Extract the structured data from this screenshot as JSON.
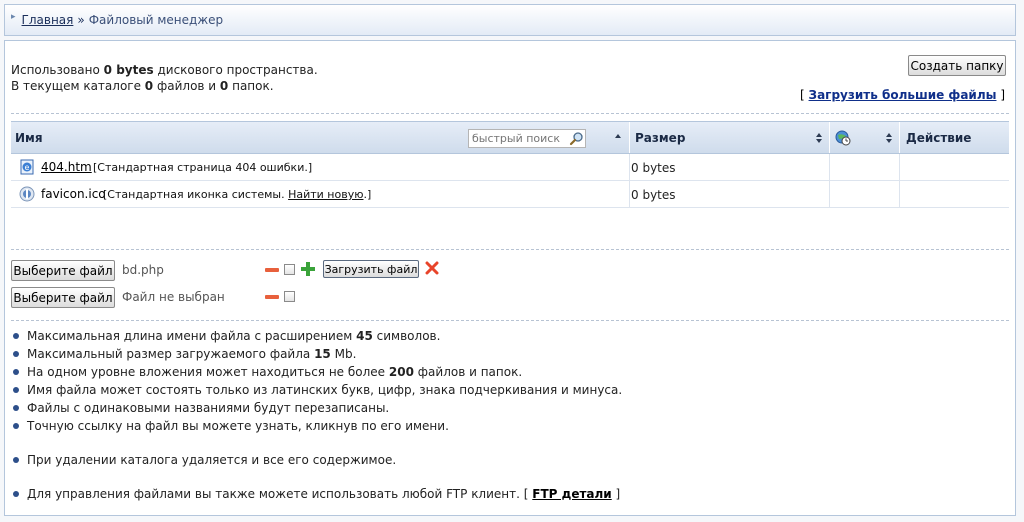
{
  "breadcrumb": {
    "home": "Главная",
    "separator": "»",
    "current": "Файловый менеджер"
  },
  "usage": {
    "line1_prefix": "Использовано",
    "used": "0 bytes",
    "line1_suffix": "дискового пространства.",
    "line2_prefix": "В текущем каталоге",
    "files_count": "0",
    "line2_mid": "файлов и",
    "folders_count": "0",
    "line2_suffix": "папок."
  },
  "toolbar": {
    "create_folder": "Создать папку",
    "upload_big_open": "[",
    "upload_big": "Загрузить большие файлы",
    "upload_big_close": "]"
  },
  "table": {
    "col_name": "Имя",
    "search_placeholder": "быстрый поиск",
    "col_size": "Размер",
    "col_action": "Действие",
    "rows": [
      {
        "name": "404.htm",
        "desc": "[Стандартная страница 404 ошибки.]",
        "size": "0 bytes",
        "icon": "html-file-icon"
      },
      {
        "name": "favicon.ico",
        "desc_prefix": "[Стандартная иконка системы.",
        "desc_link": "Найти новую",
        "desc_suffix": ".]",
        "size": "0 bytes",
        "icon": "favicon-file-icon"
      }
    ]
  },
  "upload": {
    "choose_label": "Выберите файл",
    "row1_file": "bd.php",
    "row2_file": "Файл не выбран",
    "upload_button": "Загрузить файл"
  },
  "info": {
    "i1_a": "Максимальная длина имени файла с расширением",
    "i1_b": "45",
    "i1_c": "символов.",
    "i2_a": "Максимальный размер загружаемого файла",
    "i2_b": "15",
    "i2_c": "Mb.",
    "i3_a": "На одном уровне вложения может находиться не более",
    "i3_b": "200",
    "i3_c": "файлов и папок.",
    "i4": "Имя файла может состоять только из латинских букв, цифр, знака подчеркивания и минуса.",
    "i5": "Файлы с одинаковыми названиями будут перезаписаны.",
    "i6": "Точную ссылку на файл вы можете узнать, кликнув по его имени.",
    "i7": "При удалении каталога удаляется и все его содержимое.",
    "i8_a": "Для управления файлами вы также можете использовать любой FTP клиент.",
    "i8_open": "[",
    "i8_link": "FTP детали",
    "i8_close": "]"
  },
  "colors": {
    "accent": "#0f2f8a",
    "header_bg": "#d4e0ef",
    "border": "#b4c6dc",
    "bullet": "#2d4f8a",
    "minus": "#e8603c",
    "plus": "#3aa33a",
    "delete": "#e8442a"
  }
}
